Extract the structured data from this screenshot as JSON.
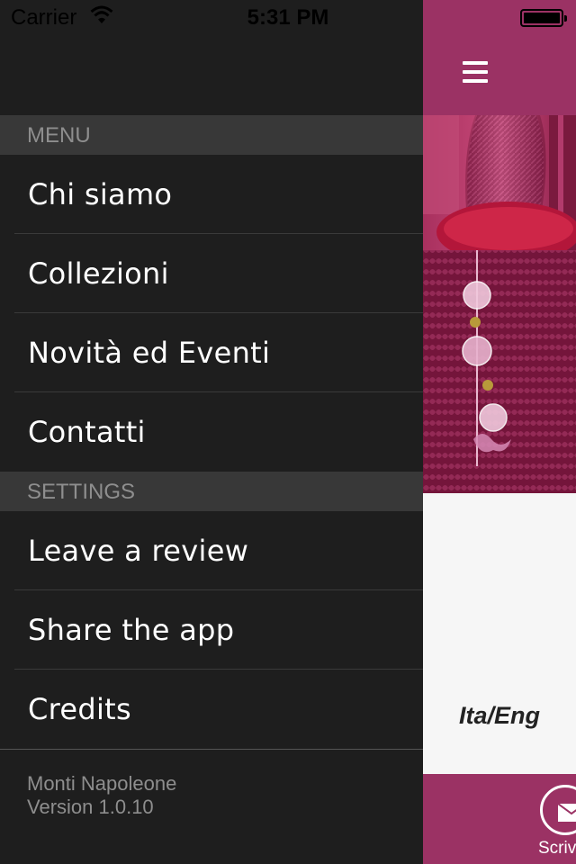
{
  "status_bar": {
    "carrier": "Carrier",
    "time": "5:31 PM",
    "wifi_icon": "wifi-icon",
    "battery_icon": "battery-full-icon"
  },
  "menu": {
    "sections": [
      {
        "header": "MENU",
        "items": [
          {
            "label": "Chi siamo"
          },
          {
            "label": "Collezioni"
          },
          {
            "label": "Novità ed Eventi"
          },
          {
            "label": "Contatti"
          }
        ]
      },
      {
        "header": "SETTINGS",
        "items": [
          {
            "label": "Leave a review"
          },
          {
            "label": "Share the app"
          },
          {
            "label": "Credits"
          }
        ]
      }
    ],
    "footer": {
      "app_name": "Monti Napoleone",
      "version": "Version 1.0.10"
    }
  },
  "main_content": {
    "menu_icon": "hamburger-menu-icon",
    "language_toggle": "Ita/Eng",
    "write_button_label": "Scriv",
    "write_icon": "envelope-icon"
  },
  "colors": {
    "drawer_background": "#1e1e1e",
    "section_header_background": "#383838",
    "accent": "#9b3264"
  }
}
